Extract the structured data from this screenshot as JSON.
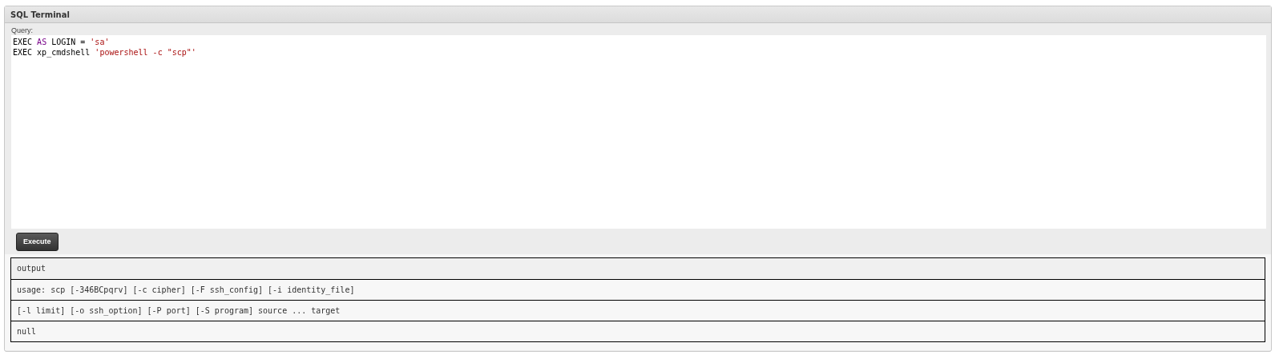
{
  "panel": {
    "title": "SQL Terminal"
  },
  "query": {
    "label": "Query:",
    "lines": [
      [
        {
          "kind": "plain",
          "text": "EXEC "
        },
        {
          "kind": "keyword",
          "text": "AS"
        },
        {
          "kind": "plain",
          "text": " LOGIN = "
        },
        {
          "kind": "string",
          "text": "'sa'"
        }
      ],
      [
        {
          "kind": "plain",
          "text": "EXEC xp_cmdshell "
        },
        {
          "kind": "string",
          "text": "'powershell -c \"scp\"'"
        }
      ]
    ]
  },
  "buttons": [
    "Execute"
  ],
  "output": {
    "header": "output",
    "rows": [
      "usage: scp [-346BCpqrv] [-c cipher] [-F ssh_config] [-i identity_file]",
      "[-l limit] [-o ssh_option] [-P port] [-S program] source ... target",
      "null"
    ]
  }
}
